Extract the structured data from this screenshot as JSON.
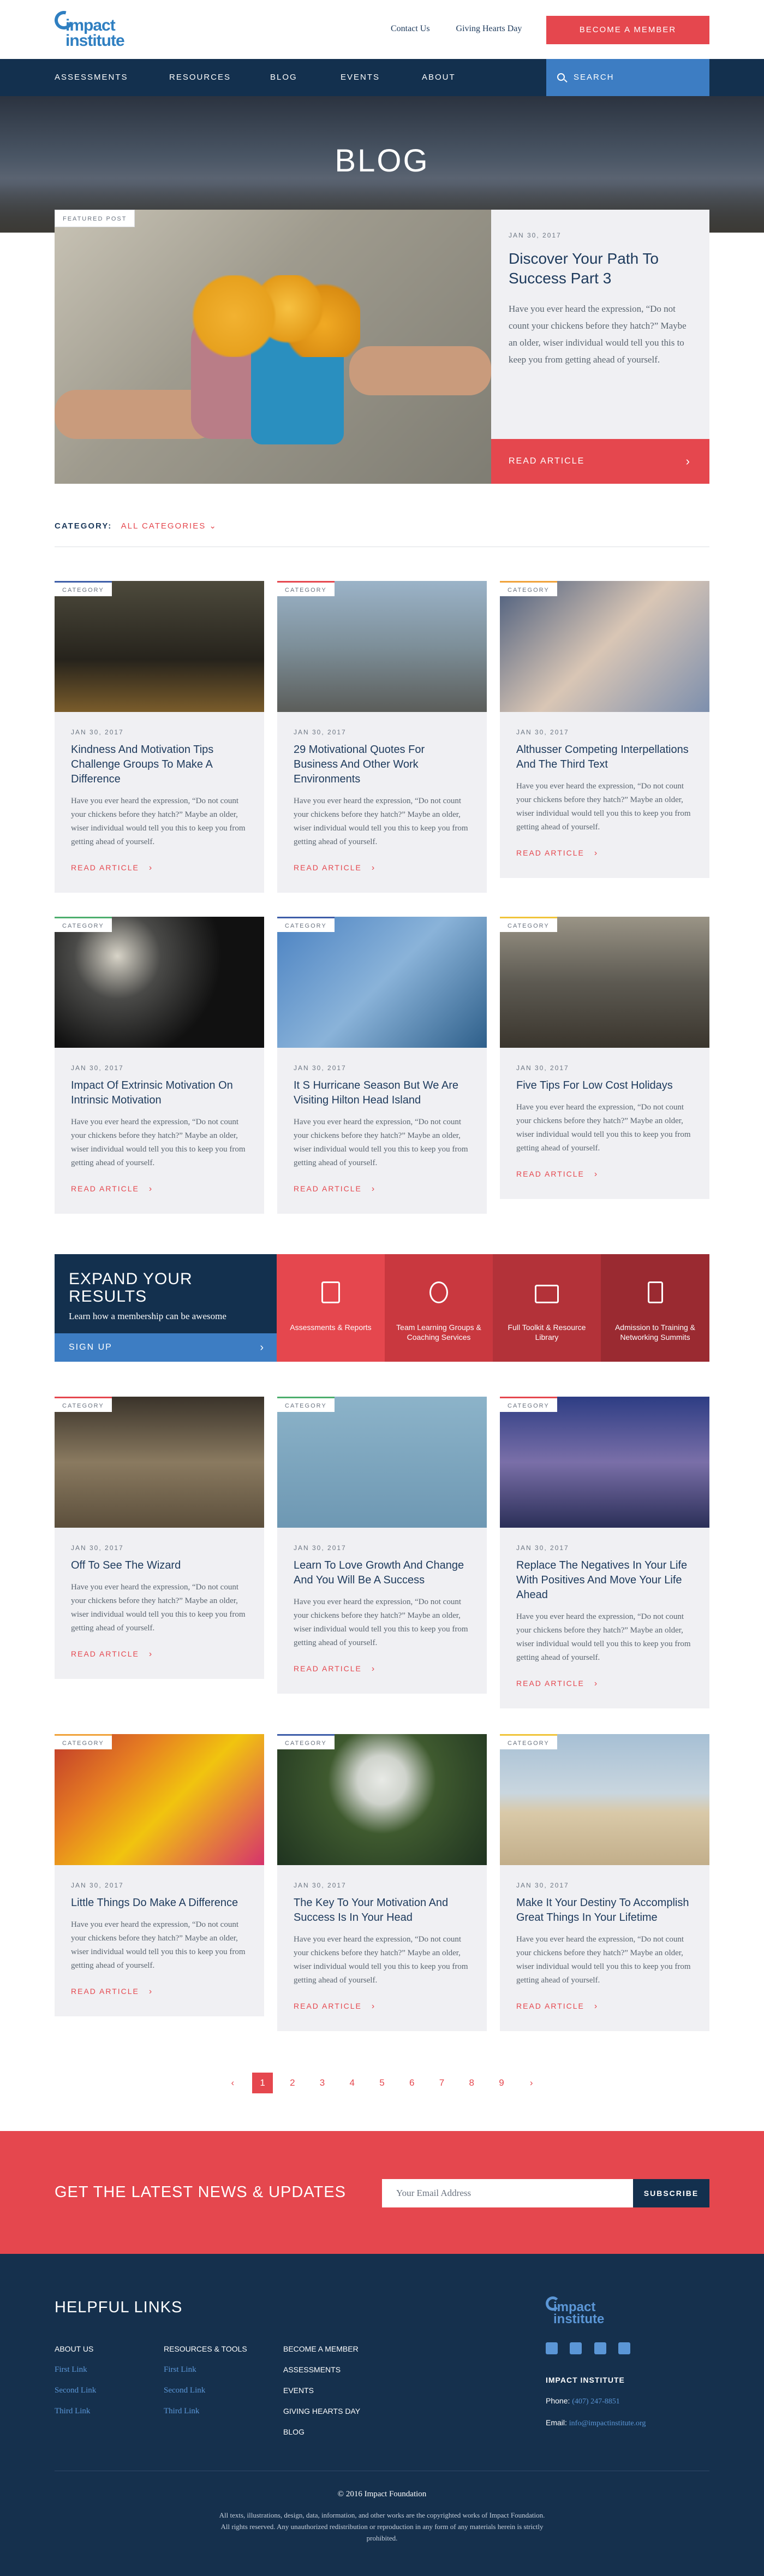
{
  "header": {
    "logo_line1": "impact",
    "logo_line2": "institute",
    "links": [
      "Contact Us",
      "Giving Hearts Day"
    ],
    "cta": "BECOME A MEMBER"
  },
  "nav": {
    "items": [
      "ASSESSMENTS",
      "RESOURCES",
      "BLOG",
      "EVENTS",
      "ABOUT"
    ],
    "search": "SEARCH"
  },
  "hero": {
    "title": "BLOG"
  },
  "featured": {
    "badge": "FEATURED POST",
    "date": "JAN 30, 2017",
    "title": "Discover Your Path To Success Part 3",
    "excerpt": "Have you ever heard the expression, “Do not count your chickens before they hatch?” Maybe an older, wiser individual would tell you this to keep you from getting ahead of yourself.",
    "cta": "READ ARTICLE"
  },
  "category": {
    "label": "CATEGORY:",
    "value": "ALL CATEGORIES"
  },
  "cards": [
    {
      "cat": "CATEGORY",
      "date": "JAN 30, 2017",
      "title": "Kindness And Motivation Tips Challenge Groups To Make A Difference",
      "excerpt": "Have you ever heard the expression, “Do not count your chickens before they hatch?” Maybe an older, wiser individual would tell you this to keep you from getting ahead of yourself.",
      "cta": "READ ARTICLE",
      "accent": "#3d5da8"
    },
    {
      "cat": "CATEGORY",
      "date": "JAN 30, 2017",
      "title": "29 Motivational Quotes For Business And Other Work Environments",
      "excerpt": "Have you ever heard the expression, “Do not count your chickens before they hatch?” Maybe an older, wiser individual would tell you this to keep you from getting ahead of yourself.",
      "cta": "READ ARTICLE",
      "accent": "#e5474e"
    },
    {
      "cat": "CATEGORY",
      "date": "JAN 30, 2017",
      "title": "Althusser Competing Interpellations And The Third Text",
      "excerpt": "Have you ever heard the expression, “Do not count your chickens before they hatch?” Maybe an older, wiser individual would tell you this to keep you from getting ahead of yourself.",
      "cta": "READ ARTICLE",
      "accent": "#f0a23a"
    },
    {
      "cat": "CATEGORY",
      "date": "JAN 30, 2017",
      "title": "Impact Of Extrinsic Motivation On Intrinsic Motivation",
      "excerpt": "Have you ever heard the expression, “Do not count your chickens before they hatch?” Maybe an older, wiser individual would tell you this to keep you from getting ahead of yourself.",
      "cta": "READ ARTICLE",
      "accent": "#4cae6d"
    },
    {
      "cat": "CATEGORY",
      "date": "JAN 30, 2017",
      "title": "It S Hurricane Season But We Are Visiting Hilton Head Island",
      "excerpt": "Have you ever heard the expression, “Do not count your chickens before they hatch?” Maybe an older, wiser individual would tell you this to keep you from getting ahead of yourself.",
      "cta": "READ ARTICLE",
      "accent": "#3d5da8"
    },
    {
      "cat": "CATEGORY",
      "date": "JAN 30, 2017",
      "title": "Five Tips For Low Cost Holidays",
      "excerpt": "Have you ever heard the expression, “Do not count your chickens before they hatch?” Maybe an older, wiser individual would tell you this to keep you from getting ahead of yourself.",
      "cta": "READ ARTICLE",
      "accent": "#f0c43a"
    },
    {
      "cat": "CATEGORY",
      "date": "JAN 30, 2017",
      "title": "Off To See The Wizard",
      "excerpt": "Have you ever heard the expression, “Do not count your chickens before they hatch?” Maybe an older, wiser individual would tell you this to keep you from getting ahead of yourself.",
      "cta": "READ ARTICLE",
      "accent": "#e5474e"
    },
    {
      "cat": "CATEGORY",
      "date": "JAN 30, 2017",
      "title": "Learn To Love Growth And Change And You Will Be A Success",
      "excerpt": "Have you ever heard the expression, “Do not count your chickens before they hatch?” Maybe an older, wiser individual would tell you this to keep you from getting ahead of yourself.",
      "cta": "READ ARTICLE",
      "accent": "#4cae6d"
    },
    {
      "cat": "CATEGORY",
      "date": "JAN 30, 2017",
      "title": "Replace The Negatives In Your Life With Positives And Move Your Life Ahead",
      "excerpt": "Have you ever heard the expression, “Do not count your chickens before they hatch?” Maybe an older, wiser individual would tell you this to keep you from getting ahead of yourself.",
      "cta": "READ ARTICLE",
      "accent": "#e5474e"
    },
    {
      "cat": "CATEGORY",
      "date": "JAN 30, 2017",
      "title": "Little Things Do Make A Difference",
      "excerpt": "Have you ever heard the expression, “Do not count your chickens before they hatch?” Maybe an older, wiser individual would tell you this to keep you from getting ahead of yourself.",
      "cta": "READ ARTICLE",
      "accent": "#f0a23a"
    },
    {
      "cat": "CATEGORY",
      "date": "JAN 30, 2017",
      "title": "The Key To Your Motivation And Success Is In Your Head",
      "excerpt": "Have you ever heard the expression, “Do not count your chickens before they hatch?” Maybe an older, wiser individual would tell you this to keep you from getting ahead of yourself.",
      "cta": "READ ARTICLE",
      "accent": "#3d5da8"
    },
    {
      "cat": "CATEGORY",
      "date": "JAN 30, 2017",
      "title": "Make It Your Destiny To Accomplish Great Things In Your Lifetime",
      "excerpt": "Have you ever heard the expression, “Do not count your chickens before they hatch?” Maybe an older, wiser individual would tell you this to keep you from getting ahead of yourself.",
      "cta": "READ ARTICLE",
      "accent": "#f0c43a"
    }
  ],
  "promo": {
    "title": "EXPAND YOUR RESULTS",
    "subtitle": "Learn how a membership can be awesome",
    "cta": "SIGN UP",
    "tiles": [
      {
        "label": "Assessments & Reports",
        "icon": "book-icon",
        "color": "#e5474e"
      },
      {
        "label": "Team Learning Groups & Coaching Services",
        "icon": "whistle-icon",
        "color": "#c9383f"
      },
      {
        "label": "Full Toolkit & Resource Library",
        "icon": "toolbox-icon",
        "color": "#b33239"
      },
      {
        "label": "Admission to Training & Networking Summits",
        "icon": "badge-icon",
        "color": "#9a2a31"
      }
    ]
  },
  "pagination": {
    "prev": "‹",
    "pages": [
      "1",
      "2",
      "3",
      "4",
      "5",
      "6",
      "7",
      "8",
      "9"
    ],
    "next": "›",
    "current": "1"
  },
  "newsletter": {
    "title": "GET THE LATEST NEWS & UPDATES",
    "placeholder": "Your Email Address",
    "cta": "SUBSCRIBE"
  },
  "footer": {
    "title": "HELPFUL LINKS",
    "col1": {
      "head": "ABOUT US",
      "links": [
        "First Link",
        "Second Link",
        "Third Link"
      ]
    },
    "col2": {
      "head": "RESOURCES & TOOLS",
      "links": [
        "First Link",
        "Second Link",
        "Third Link"
      ]
    },
    "col3": [
      "BECOME A MEMBER",
      "ASSESSMENTS",
      "EVENTS",
      "GIVING HEARTS DAY",
      "BLOG"
    ],
    "logo_line1": "impact",
    "logo_line2": "institute",
    "org": "IMPACT INSTITUTE",
    "phone_label": "Phone:",
    "phone": "(407) 247-8851",
    "email_label": "Email:",
    "email": "info@impactinstitute.org",
    "copyright": "© 2016 Impact Foundation",
    "legal": "All texts, illustrations, design, data, information, and other works are the copyrighted works of Impact Foundation. All rights reserved. Any unauthorized redistribution or reproduction in any form of any materials herein is strictly prohibited."
  }
}
